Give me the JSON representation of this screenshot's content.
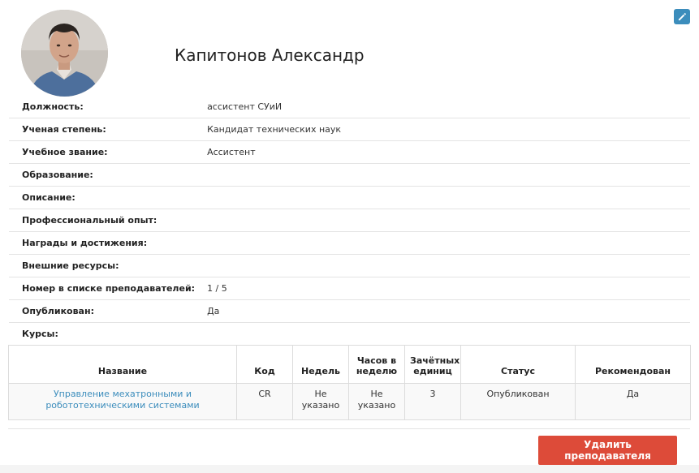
{
  "profile": {
    "name": "Капитонов Александр",
    "edit_icon": "pencil-icon",
    "accent_color": "#3c8dbc"
  },
  "fields": [
    {
      "label": "Должность:",
      "value": "ассистент СУиИ"
    },
    {
      "label": "Ученая степень:",
      "value": "Кандидат технических наук"
    },
    {
      "label": "Учебное звание:",
      "value": "Ассистент"
    },
    {
      "label": "Образование:",
      "value": ""
    },
    {
      "label": "Описание:",
      "value": ""
    },
    {
      "label": "Профессиональный опыт:",
      "value": ""
    },
    {
      "label": "Награды и достижения:",
      "value": ""
    },
    {
      "label": "Внешние ресурсы:",
      "value": ""
    },
    {
      "label": "Номер в списке преподавателей:",
      "value": "1 / 5"
    },
    {
      "label": "Опубликован:",
      "value": "Да"
    },
    {
      "label": "Курсы:",
      "value": ""
    }
  ],
  "courses": {
    "headers": [
      "Название",
      "Код",
      "Недель",
      "Часов в неделю",
      "Зачётных единиц",
      "Статус",
      "Рекомендован"
    ],
    "rows": [
      [
        "Управление мехатронными и робототехническими системами",
        "CR",
        "Не указано",
        "Не указано",
        "3",
        "Опубликован",
        "Да"
      ]
    ]
  },
  "actions": {
    "delete_label": "Удалить преподавателя",
    "delete_color": "#dd4b39"
  }
}
